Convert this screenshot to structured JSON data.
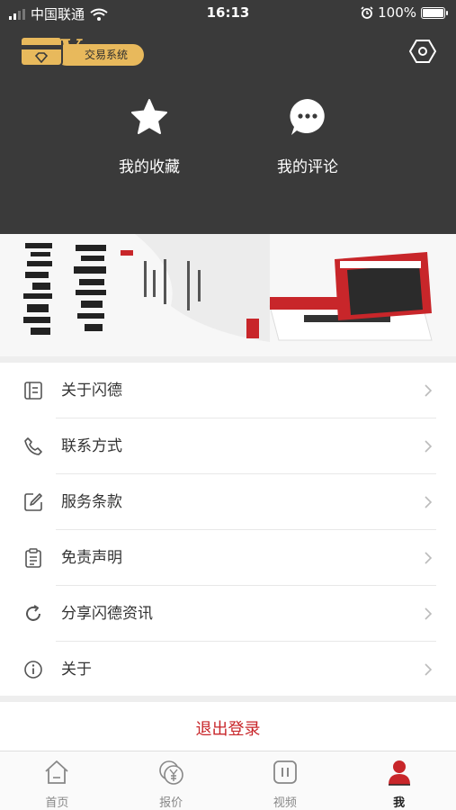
{
  "status_bar": {
    "carrier": "中国联通",
    "time": "16:13",
    "battery": "100%"
  },
  "header": {
    "logo_text": "交易系统",
    "favorites_label": "我的收藏",
    "comments_label": "我的评论"
  },
  "menu": {
    "items": [
      {
        "label": "关于闪德",
        "icon": "document-icon"
      },
      {
        "label": "联系方式",
        "icon": "phone-icon"
      },
      {
        "label": "服务条款",
        "icon": "edit-icon"
      },
      {
        "label": "免责声明",
        "icon": "clipboard-icon"
      },
      {
        "label": "分享闪德资讯",
        "icon": "share-icon"
      },
      {
        "label": "关于",
        "icon": "info-icon"
      }
    ]
  },
  "logout_label": "退出登录",
  "tabbar": {
    "tabs": [
      {
        "label": "首页",
        "icon": "home-icon"
      },
      {
        "label": "报价",
        "icon": "yuan-icon"
      },
      {
        "label": "视频",
        "icon": "video-icon"
      },
      {
        "label": "我",
        "icon": "user-icon"
      }
    ],
    "active": "我"
  },
  "colors": {
    "header_bg": "#3a3a3a",
    "accent": "#c8262a",
    "gold": "#e8b95c"
  }
}
